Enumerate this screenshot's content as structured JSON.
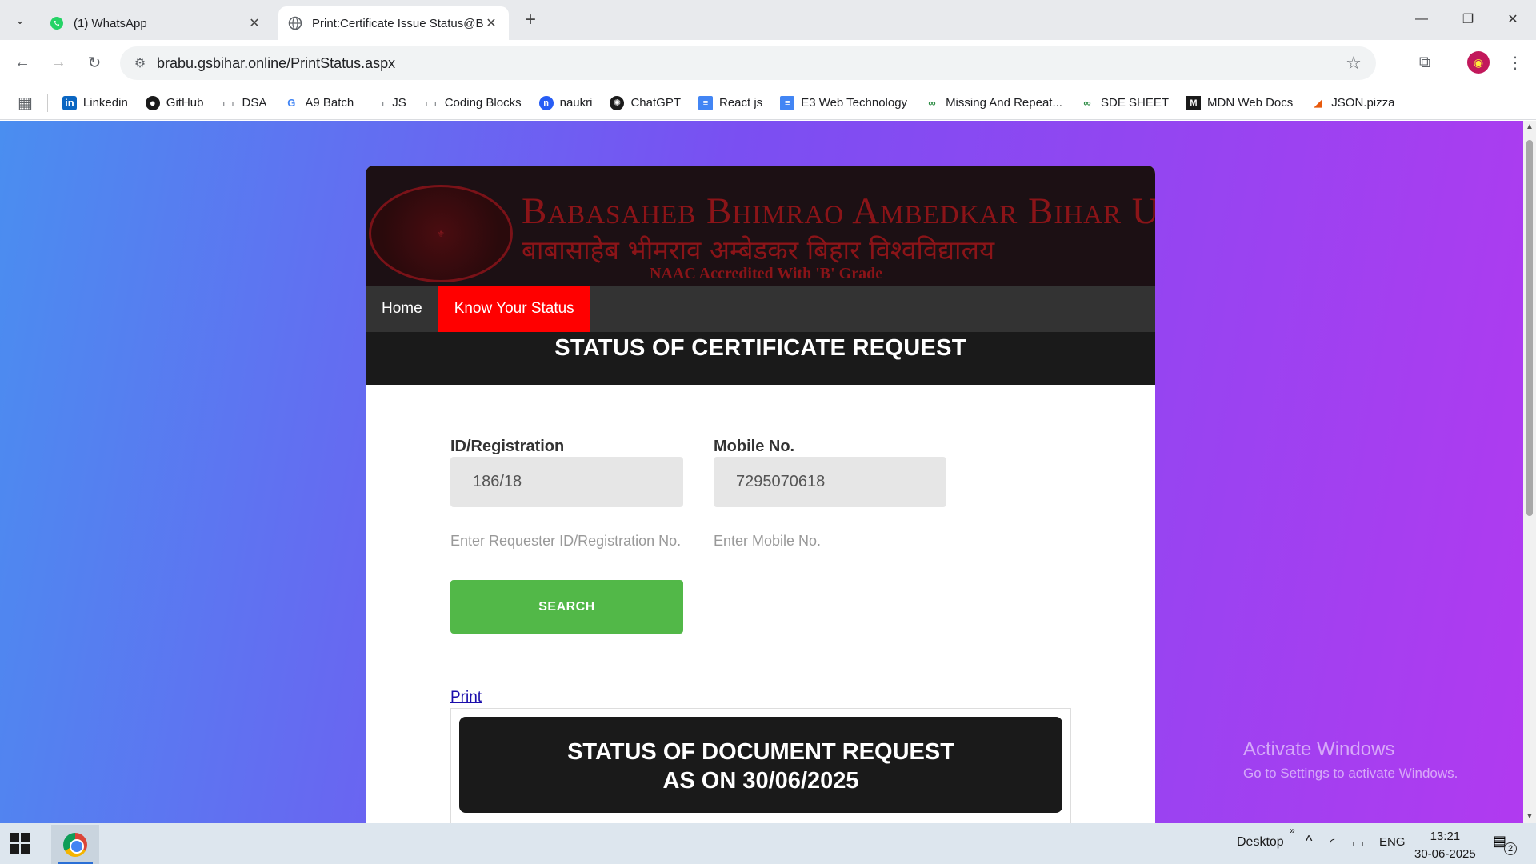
{
  "browser": {
    "tabs": [
      {
        "title": "(1) WhatsApp",
        "active": false,
        "icon": "whatsapp-icon"
      },
      {
        "title": "Print:Certificate Issue Status@BI",
        "active": true,
        "icon": "globe-icon"
      }
    ],
    "url": "brabu.gsbihar.online/PrintStatus.aspx",
    "bookmarks": [
      "Linkedin",
      "GitHub",
      "DSA",
      "A9 Batch",
      "JS",
      "Coding Blocks",
      "naukri",
      "ChatGPT",
      "React js",
      "E3 Web Technology",
      "Missing And Repeat...",
      "SDE SHEET",
      "MDN Web Docs",
      "JSON.pizza"
    ]
  },
  "page": {
    "university_en": "Babasaheb Bhimrao Ambedkar Bihar University",
    "university_hi": "बाबासाहेब भीमराव अम्बेडकर बिहार विश्वविद्यालय",
    "naac": "NAAC Accredited With 'B' Grade",
    "nav": [
      "Home",
      "Know Your Status"
    ],
    "nav_active": "Know Your Status",
    "heading": "STATUS OF CERTIFICATE REQUEST",
    "form": {
      "id_label": "ID/Registration",
      "id_value": "186/18",
      "id_help": "Enter Requester ID/Registration No.",
      "mobile_label": "Mobile No.",
      "mobile_value": "7295070618",
      "mobile_help": "Enter Mobile No.",
      "search_label": "SEARCH"
    },
    "print_label": "Print",
    "doc_heading_line1": "STATUS OF DOCUMENT REQUEST",
    "doc_heading_line2": "AS ON 30/06/2025"
  },
  "watermark": {
    "line1": "Activate Windows",
    "line2": "Go to Settings to activate Windows."
  },
  "taskbar": {
    "desktop_label": "Desktop",
    "language": "ENG",
    "time": "13:21",
    "date": "30-06-2025",
    "notifications": "2"
  },
  "colors": {
    "accent_red": "#ff0000",
    "search_green": "#52b848",
    "gradient_start": "#4a8ef0",
    "gradient_end": "#b13af0"
  }
}
